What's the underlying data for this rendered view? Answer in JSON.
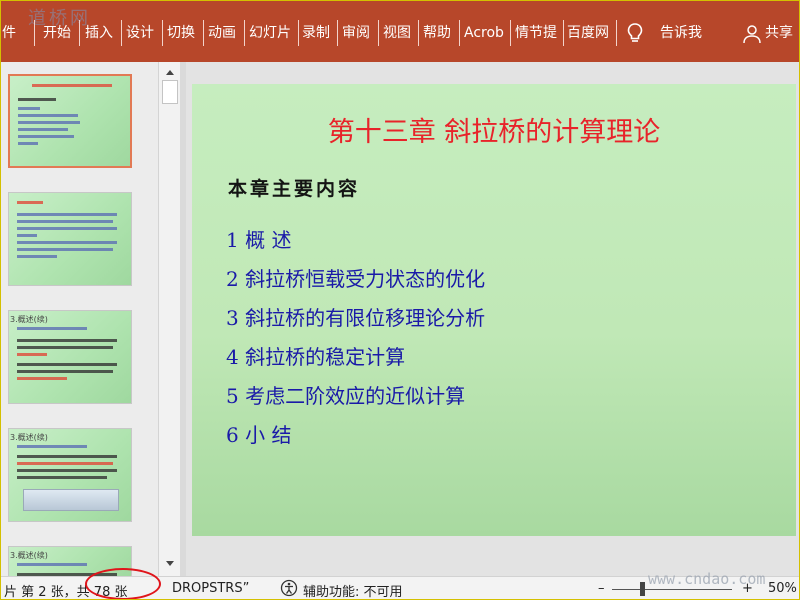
{
  "ribbon": {
    "tabs": [
      "件",
      "开始",
      "插入",
      "设计",
      "切换",
      "动画",
      "幻灯片",
      "录制",
      "审阅",
      "视图",
      "帮助",
      "Acrob",
      "情节提",
      "百度网"
    ],
    "tell_me": "告诉我",
    "share": "共享",
    "watermark": "道桥网",
    "bg_color": "#b7472a"
  },
  "thumbnails": {
    "slide3_label": "3.概述(续)",
    "slide4_label": "3.概述(续)",
    "slide5_label": "3.概述(续)"
  },
  "slide": {
    "title": "第十三章   斜拉桥的计算理论",
    "subtitle": "本章主要内容",
    "items": [
      "1  概  述",
      "2  斜拉桥恒载受力状态的优化",
      "3  斜拉桥的有限位移理论分析",
      "4  斜拉桥的稳定计算",
      "5  考虑二阶效应的近似计算",
      "6  小  结"
    ],
    "title_color": "#e8232a",
    "item_color": "#1a1aa8"
  },
  "statusbar": {
    "slide_info": "片 第 2 张，共 78 张",
    "theme": "DROPSTRS”",
    "accessibility": "辅助功能: 不可用",
    "zoom_minus": "–",
    "zoom_plus": "+",
    "zoom_percent": "50%",
    "watermark": "www.cndao.com"
  }
}
